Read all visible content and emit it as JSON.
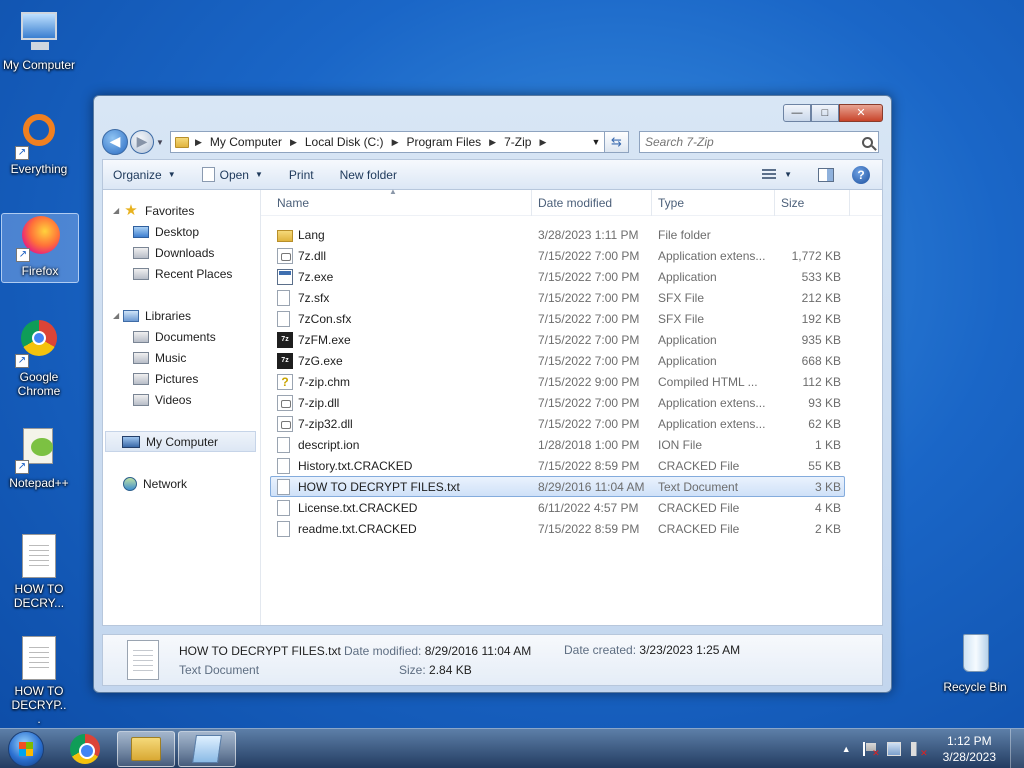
{
  "desktop": {
    "icons": [
      {
        "label": "My Computer"
      },
      {
        "label": "Everything"
      },
      {
        "label": "Firefox"
      },
      {
        "label": "Google Chrome"
      },
      {
        "label": "Notepad++"
      },
      {
        "label": "HOW TO DECRY..."
      },
      {
        "label": "HOW TO DECRYP..."
      },
      {
        "label": "Recycle Bin"
      }
    ]
  },
  "window": {
    "controls": {
      "minimize": "—",
      "maximize": "□",
      "close": "✕"
    },
    "breadcrumb": [
      "My Computer",
      "Local Disk (C:)",
      "Program Files",
      "7-Zip"
    ],
    "search_placeholder": "Search 7-Zip",
    "toolbar": {
      "organize": "Organize",
      "open": "Open",
      "print": "Print",
      "new_folder": "New folder"
    },
    "nav": {
      "favorites": "Favorites",
      "desktop": "Desktop",
      "downloads": "Downloads",
      "recent": "Recent Places",
      "libraries": "Libraries",
      "documents": "Documents",
      "music": "Music",
      "pictures": "Pictures",
      "videos": "Videos",
      "my_computer": "My Computer",
      "network": "Network"
    },
    "columns": {
      "name": "Name",
      "date": "Date modified",
      "type": "Type",
      "size": "Size"
    },
    "files": [
      {
        "name": "Lang",
        "date": "3/28/2023 1:11 PM",
        "type": "File folder",
        "size": "",
        "icon": "folder"
      },
      {
        "name": "7z.dll",
        "date": "7/15/2022 7:00 PM",
        "type": "Application extens...",
        "size": "1,772 KB",
        "icon": "dll"
      },
      {
        "name": "7z.exe",
        "date": "7/15/2022 7:00 PM",
        "type": "Application",
        "size": "533 KB",
        "icon": "app"
      },
      {
        "name": "7z.sfx",
        "date": "7/15/2022 7:00 PM",
        "type": "SFX File",
        "size": "212 KB",
        "icon": "doc"
      },
      {
        "name": "7zCon.sfx",
        "date": "7/15/2022 7:00 PM",
        "type": "SFX File",
        "size": "192 KB",
        "icon": "doc"
      },
      {
        "name": "7zFM.exe",
        "date": "7/15/2022 7:00 PM",
        "type": "Application",
        "size": "935 KB",
        "icon": "zip"
      },
      {
        "name": "7zG.exe",
        "date": "7/15/2022 7:00 PM",
        "type": "Application",
        "size": "668 KB",
        "icon": "zip"
      },
      {
        "name": "7-zip.chm",
        "date": "7/15/2022 9:00 PM",
        "type": "Compiled HTML ...",
        "size": "112 KB",
        "icon": "chm"
      },
      {
        "name": "7-zip.dll",
        "date": "7/15/2022 7:00 PM",
        "type": "Application extens...",
        "size": "93 KB",
        "icon": "dll"
      },
      {
        "name": "7-zip32.dll",
        "date": "7/15/2022 7:00 PM",
        "type": "Application extens...",
        "size": "62 KB",
        "icon": "dll"
      },
      {
        "name": "descript.ion",
        "date": "1/28/2018 1:00 PM",
        "type": "ION File",
        "size": "1 KB",
        "icon": "doc"
      },
      {
        "name": "History.txt.CRACKED",
        "date": "7/15/2022 8:59 PM",
        "type": "CRACKED File",
        "size": "55 KB",
        "icon": "doc"
      },
      {
        "name": "HOW TO DECRYPT FILES.txt",
        "date": "8/29/2016 11:04 AM",
        "type": "Text Document",
        "size": "3 KB",
        "icon": "doc"
      },
      {
        "name": "License.txt.CRACKED",
        "date": "6/11/2022 4:57 PM",
        "type": "CRACKED File",
        "size": "4 KB",
        "icon": "doc"
      },
      {
        "name": "readme.txt.CRACKED",
        "date": "7/15/2022 8:59 PM",
        "type": "CRACKED File",
        "size": "2 KB",
        "icon": "doc"
      }
    ],
    "selected_index": 12,
    "details": {
      "filename": "HOW TO DECRYPT FILES.txt",
      "filetype": "Text Document",
      "modified_label": "Date modified:",
      "modified_value": "8/29/2016 11:04 AM",
      "created_label": "Date created:",
      "created_value": "3/23/2023 1:25 AM",
      "size_label": "Size:",
      "size_value": "2.84 KB"
    }
  },
  "taskbar": {
    "time": "1:12 PM",
    "date": "3/28/2023"
  }
}
